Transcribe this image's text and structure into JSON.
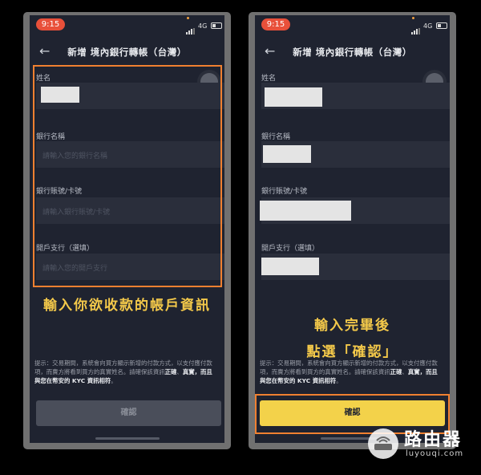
{
  "status": {
    "time": "9:15",
    "network": "4G"
  },
  "header": {
    "title": "新增 境內銀行轉帳（台灣）"
  },
  "form": {
    "name_label": "姓名",
    "bank_label": "銀行名稱",
    "bank_placeholder": "請輸入您的銀行名稱",
    "account_label": "銀行賬號/卡號",
    "account_placeholder": "請輸入銀行賬號/卡號",
    "branch_label": "開戶支行（選填）",
    "branch_placeholder": "請輸入您的開戶支行"
  },
  "notice": {
    "text_a": "提示：交易期間，系統會向買方顯示新增的付款方式，以支付應付款項，而賣方將看到買方的真實姓名。請確保該資訊",
    "em1": "正確",
    "sep": "、",
    "em2": "真實",
    "text_b": "，而且與您在幣安的 KYC 資訊相符",
    "end": "。"
  },
  "confirm_label": "確認",
  "captions": {
    "left": "輸入你欲收款的帳戶資訊",
    "right_line1": "輸入完畢後",
    "right_line2": "點選「確認」"
  },
  "watermark": {
    "name": "路由器",
    "url": "luyouqi.com"
  },
  "colors": {
    "accent_yellow": "#f3d24a",
    "highlight_orange": "#f08030",
    "caption_yellow": "#f4c94a"
  }
}
